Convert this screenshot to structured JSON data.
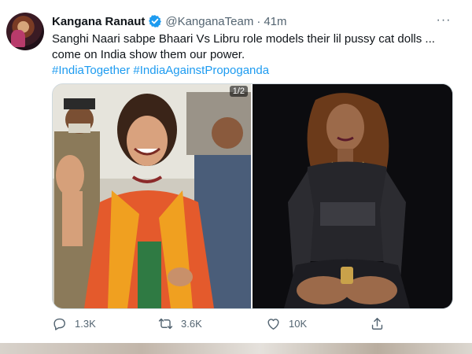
{
  "tweet": {
    "author_name": "Kangana Ranaut",
    "handle": "@KanganaTeam",
    "separator": "·",
    "time": "41m",
    "more_label": "···",
    "text_line1": "Sanghi Naari sabpe Bhaari Vs Libru role models their lil pussy cat dolls ...",
    "text_line2": "come on India show them our power.",
    "hashtags": [
      "#IndiaTogether",
      "#IndiaAgainstPropoganda"
    ],
    "media_count": "1/2",
    "stats": {
      "replies": "1.3K",
      "retweets": "3.6K",
      "likes": "10K"
    }
  },
  "colors": {
    "link": "#1d9bf0",
    "verified": "#1d9bf0",
    "muted": "#536471"
  },
  "icons": [
    "verified-badge-icon",
    "more-icon",
    "reply-icon",
    "retweet-icon",
    "like-icon",
    "share-icon"
  ]
}
